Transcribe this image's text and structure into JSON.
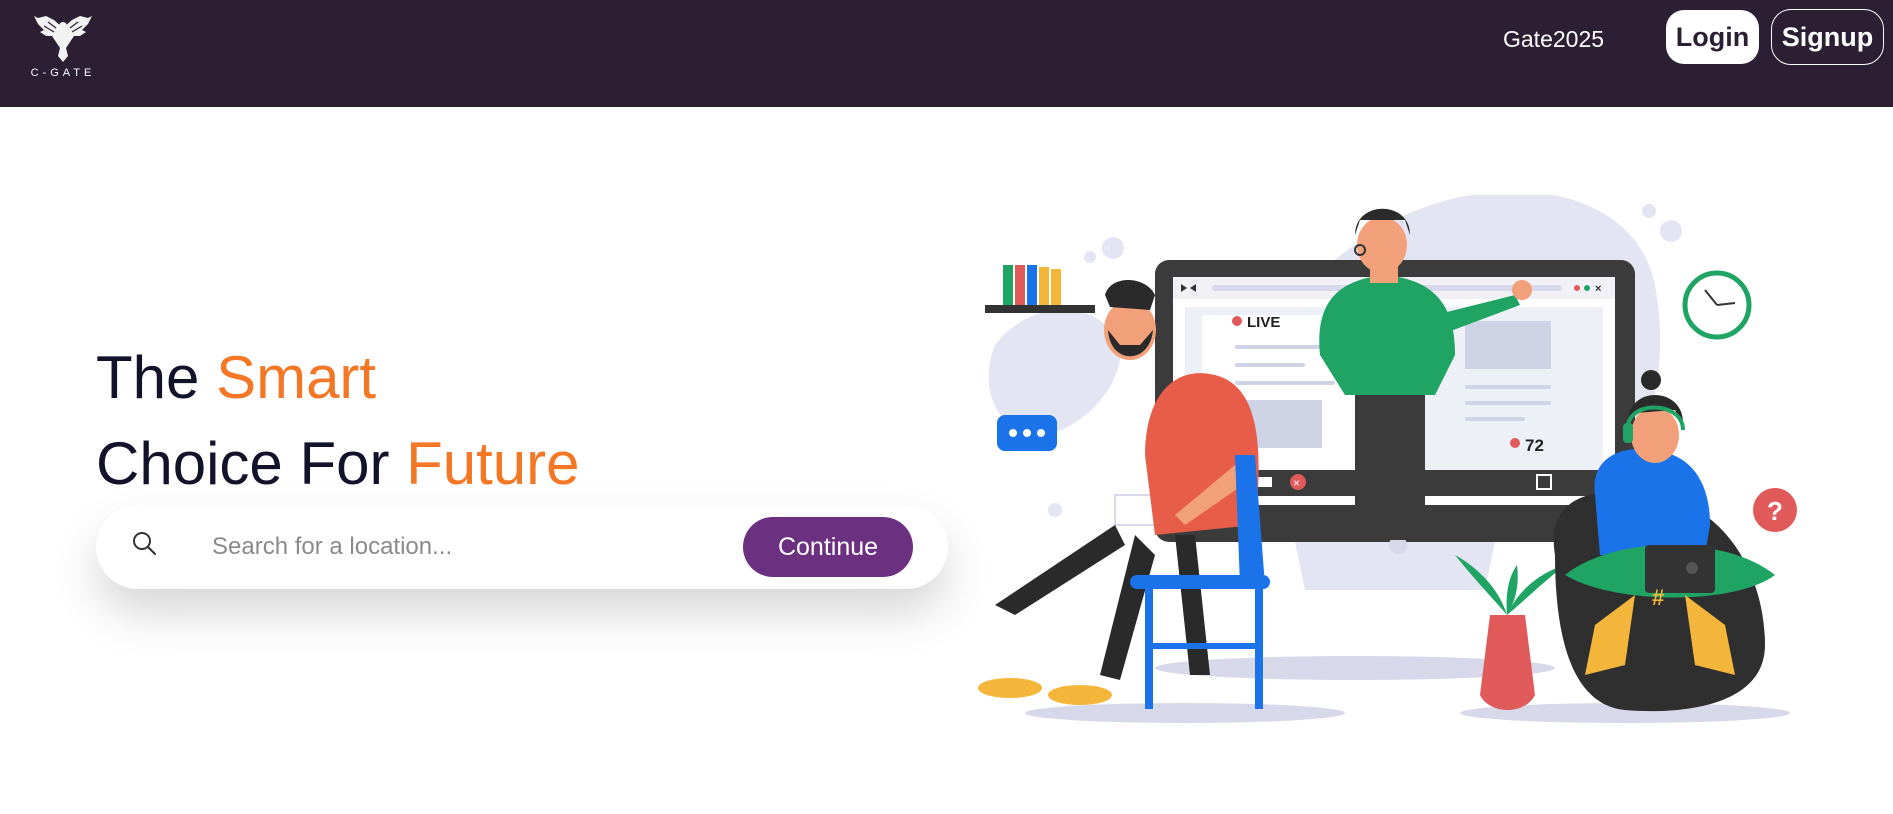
{
  "navbar": {
    "logo_text": "C-GATE",
    "link_label": "Gate2025",
    "login_label": "Login",
    "signup_label": "Signup"
  },
  "hero": {
    "title_line1_start": "The ",
    "title_line1_accent": "Smart",
    "title_line2_start": "Choice For ",
    "title_line2_accent": "Future"
  },
  "search": {
    "placeholder": "Search for a location...",
    "value": "",
    "button_label": "Continue"
  },
  "illustration": {
    "live_label": "LIVE",
    "viewer_count": "72",
    "hashtag": "#"
  },
  "colors": {
    "navbar_bg": "#2d1f33",
    "accent": "#f47726",
    "button_primary": "#6b3080",
    "heading": "#12132b"
  },
  "icons": [
    "eagle-logo-icon",
    "search-icon",
    "clock-icon",
    "question-icon",
    "chat-bubble-icon"
  ]
}
